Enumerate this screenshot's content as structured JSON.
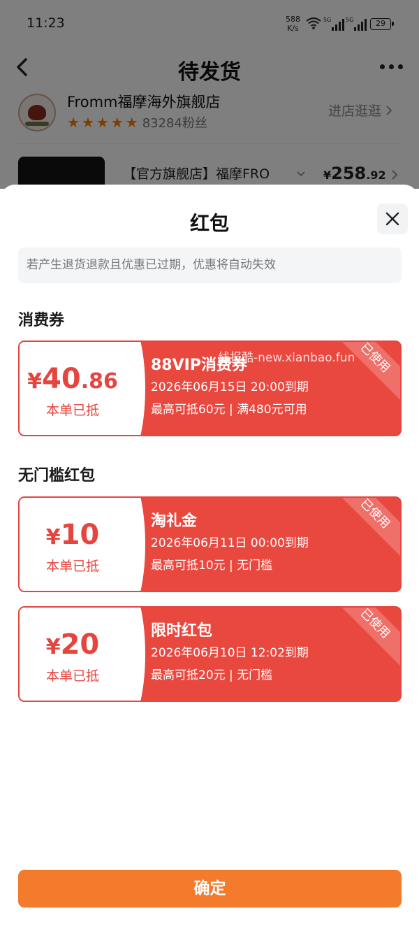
{
  "status_bar": {
    "time": "11:23",
    "net_speed_value": "588",
    "net_speed_unit": "K/s",
    "signal_1_label": "5G",
    "signal_2_label": "5G",
    "battery": "29"
  },
  "nav": {
    "title": "待发货"
  },
  "shop": {
    "name": "Fromm福摩海外旗舰店",
    "rating_stars": 5,
    "fans": "83284粉丝",
    "visit_label": "进店逛逛"
  },
  "product": {
    "title": "【官方旗舰店】福摩FRO",
    "price_symbol": "¥",
    "price_int": "258",
    "price_dec": ".92"
  },
  "sheet": {
    "title": "红包",
    "notice": "若产生退货退款且优惠已过期，优惠将自动失效",
    "watermark": "线报酷-new.xianbao.fun",
    "confirm_label": "确定"
  },
  "sections": {
    "consumer_coupons": "消费券",
    "no_threshold": "无门槛红包"
  },
  "coupons": [
    {
      "currency": "¥",
      "amount_int": "40",
      "amount_dec": ".86",
      "deducted_label": "本单已抵",
      "name": "88VIP消费券",
      "expire": "2026年06月15日 20:00到期",
      "limit": "最高可抵60元 | 满480元可用",
      "status": "已使用"
    },
    {
      "currency": "¥",
      "amount_int": "10",
      "amount_dec": "",
      "deducted_label": "本单已抵",
      "name": "淘礼金",
      "expire": "2026年06月11日 00:00到期",
      "limit": "最高可抵10元 | 无门槛",
      "status": "已使用"
    },
    {
      "currency": "¥",
      "amount_int": "20",
      "amount_dec": "",
      "deducted_label": "本单已抵",
      "name": "限时红包",
      "expire": "2026年06月10日 12:02到期",
      "limit": "最高可抵20元 | 无门槛",
      "status": "已使用"
    }
  ],
  "colors": {
    "coupon_red": "#e9483f",
    "confirm_orange": "#f47a2c",
    "star_orange": "#ff7a00"
  }
}
